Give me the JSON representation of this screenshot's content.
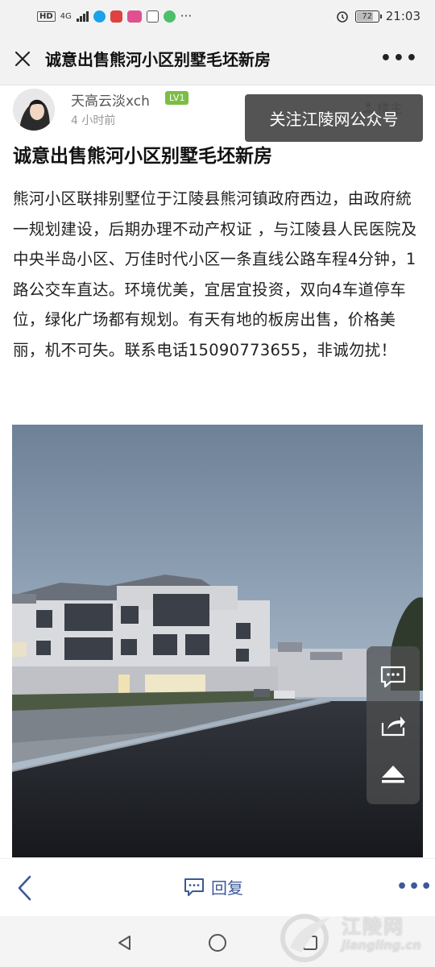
{
  "status_bar": {
    "network": "4G",
    "hd": "HD",
    "battery": "72",
    "time": "21:03",
    "more": "···"
  },
  "header": {
    "title": "诚意出售熊河小区别墅毛坯新房",
    "more": "•••"
  },
  "author": {
    "name": "天高云淡xch",
    "level": "LV1",
    "time": "4 小时前",
    "role": "楼主"
  },
  "follow_banner": "关注江陵网公众号",
  "post": {
    "title": "诚意出售熊河小区别墅毛坯新房",
    "body": "熊河小区联排别墅位于江陵县熊河镇政府西边，由政府統一规划建设，后期办理不动产权证 ，与江陵县人民医院及中央半岛小区、万佳时代小区一条直线公路车程4分钟，1路公交车直达。环境优美，宜居宜投资，双向4车道停车位，绿化广场都有规划。有天有地的板房出售，价格美丽，机不可失。联系电话15090773655，非诚勿扰！"
  },
  "bottom_bar": {
    "reply": "回复",
    "more": "•••"
  },
  "watermark": {
    "name": "江陵网",
    "domain": "jiangling.cn"
  },
  "colors": {
    "accent": "#3b5998",
    "level_badge": "#7cbd45",
    "bar_bg": "#f2f2f2"
  }
}
